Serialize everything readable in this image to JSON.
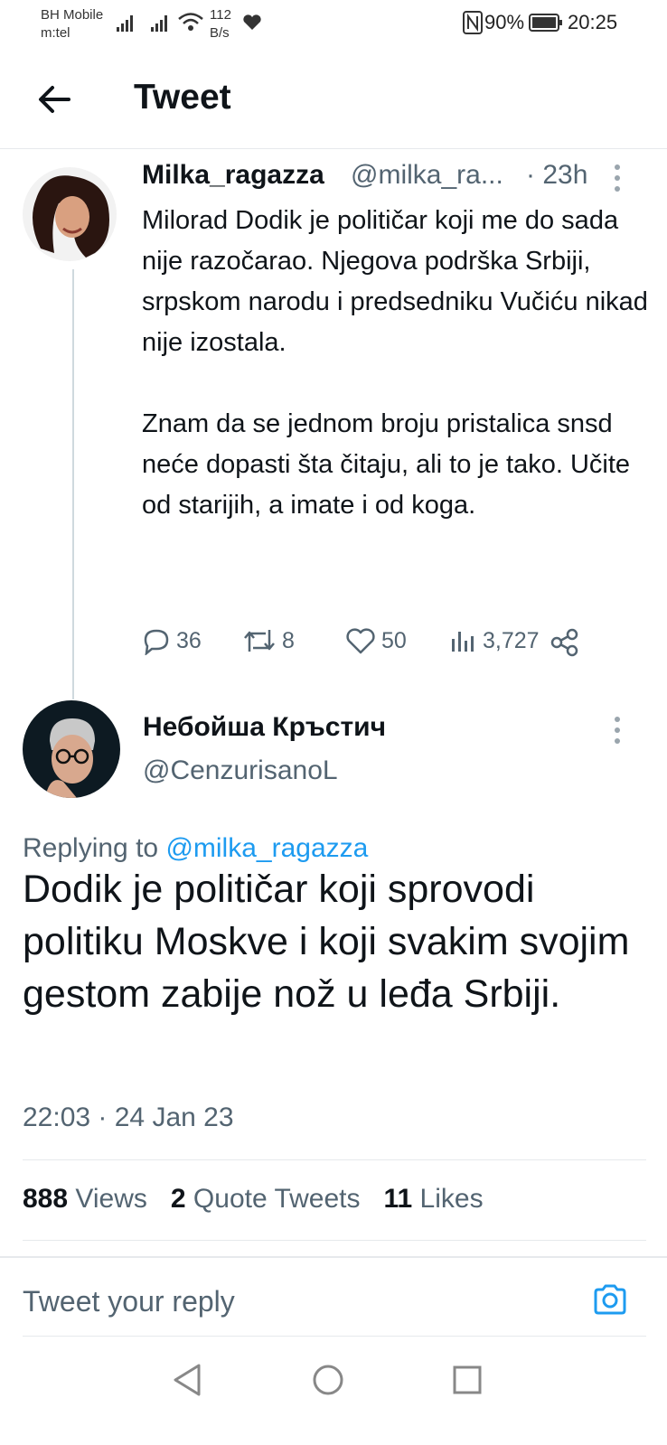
{
  "status_bar": {
    "carrier1": "BH Mobile",
    "carrier2": "m:tel",
    "speed_value": "112",
    "speed_unit": "B/s",
    "battery": "90%",
    "time": "20:25"
  },
  "header": {
    "title": "Tweet"
  },
  "parent_tweet": {
    "display_name": "Milka_ragazza",
    "handle": "@milka_ra...",
    "age": "· 23h",
    "text": "Milorad Dodik je političar koji me do sada nije razočarao. Njegova podrška Srbiji, srpskom narodu i predsedniku Vučiću nikad nije izostala.\n\nZnam da se jednom broju pristalica snsd neće dopasti šta čitaju, ali to je tako. Učite od starijih, a imate i od koga.",
    "replies": "36",
    "retweets": "8",
    "likes": "50",
    "views": "3,727"
  },
  "main_tweet": {
    "display_name": "Небойша Кръстич",
    "handle": "@CenzurisanoL",
    "replying_prefix": "Replying to",
    "replying_to": "@milka_ragazza",
    "text": "Dodik je političar koji sprovodi politiku Moskve i koji svakim svojim gestom zabije nož u leđa Srbiji.",
    "timestamp": "22:03 · 24 Jan 23",
    "views_count": "888",
    "views_label": "Views",
    "quotes_count": "2",
    "quotes_label": "Quote Tweets",
    "likes_count": "11",
    "likes_label": "Likes"
  },
  "reply_box": {
    "placeholder": "Tweet your reply"
  },
  "colors": {
    "accent": "#1d9bf0",
    "secondary_text": "#536471",
    "primary_text": "#0f1419"
  }
}
